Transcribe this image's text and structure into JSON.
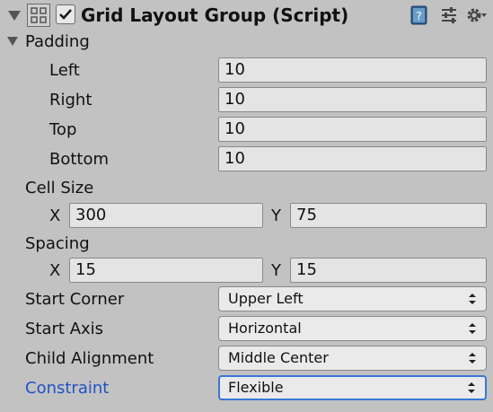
{
  "header": {
    "title": "Grid Layout Group (Script)",
    "enabled": true,
    "icons": [
      "foldout-arrow-icon",
      "grid-layout-component-icon",
      "help-book-icon",
      "preset-sliders-icon",
      "gear-icon"
    ]
  },
  "padding": {
    "label": "Padding",
    "left_label": "Left",
    "left_value": "10",
    "right_label": "Right",
    "right_value": "10",
    "top_label": "Top",
    "top_value": "10",
    "bottom_label": "Bottom",
    "bottom_value": "10"
  },
  "cell_size": {
    "label": "Cell Size",
    "x_label": "X",
    "x_value": "300",
    "y_label": "Y",
    "y_value": "75"
  },
  "spacing": {
    "label": "Spacing",
    "x_label": "X",
    "x_value": "15",
    "y_label": "Y",
    "y_value": "15"
  },
  "start_corner": {
    "label": "Start Corner",
    "value": "Upper Left"
  },
  "start_axis": {
    "label": "Start Axis",
    "value": "Horizontal"
  },
  "child_alignment": {
    "label": "Child Alignment",
    "value": "Middle Center"
  },
  "constraint": {
    "label": "Constraint",
    "value": "Flexible",
    "label_color": "#1f53c7",
    "focus_color": "#3a76d6"
  }
}
